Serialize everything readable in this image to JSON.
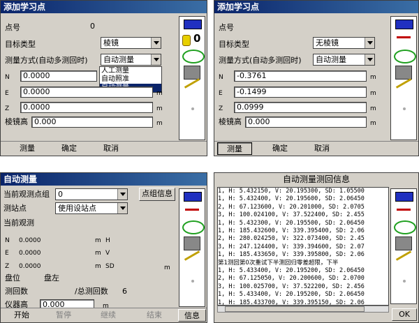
{
  "p1": {
    "title": "添加学习点",
    "point_no_label": "点号",
    "point_no_value": "0",
    "target_type_label": "目标类型",
    "target_type_value": "棱镜",
    "mode_label": "测量方式(自动多测回时)",
    "mode_value": "自动测量",
    "dropdown_options": [
      "人工测量",
      "自动照准",
      "自动测量"
    ],
    "n_label": "N",
    "n_value": "0.0000",
    "e_label": "E",
    "e_value": "0.0000",
    "z_label": "Z",
    "z_value": "0.0000",
    "prism_label": "棱镜高",
    "prism_value": "0.000",
    "unit": "m",
    "side_count": "0",
    "buttons": [
      "测量",
      "确定",
      "取消"
    ]
  },
  "p2": {
    "title": "添加学习点",
    "point_no_label": "点号",
    "target_type_label": "目标类型",
    "target_type_value": "无棱镜",
    "mode_label": "测量方式(自动多测回时)",
    "mode_value": "自动测量",
    "n_label": "N",
    "n_value": "-0.3761",
    "e_label": "E",
    "e_value": "-0.1499",
    "z_label": "Z",
    "z_value": "0.0999",
    "prism_label": "棱镜高",
    "prism_value": "0.000",
    "unit": "m",
    "buttons": [
      "测量",
      "确定",
      "取消"
    ]
  },
  "p3": {
    "title": "自动测量",
    "group_label": "当前观测点组",
    "group_value": "0",
    "group_btn": "点组信息",
    "station_label": "测站点",
    "station_value": "使用设站点",
    "obs_label": "当前观测",
    "n_label": "N",
    "n_value": "0.0000",
    "n_unit": "m",
    "n_right": "H",
    "e_label": "E",
    "e_value": "0.0000",
    "e_unit": "m",
    "e_right": "V",
    "z_label": "Z",
    "z_value": "0.0000",
    "z_unit": "m",
    "z_right": "SD",
    "z_unit2": "m",
    "face_label": "盘位",
    "face_value": "盘左",
    "rounds_label": "测回数",
    "total_label": "/总测回数",
    "total_value": "6",
    "inst_label": "仪器高",
    "inst_value": "0.000",
    "inst_unit": "m",
    "buttons": [
      "开始",
      "暂停",
      "继续",
      "结束",
      "信息"
    ]
  },
  "p4": {
    "title": "自动测量测回信息",
    "ok": "OK",
    "lines": [
      "1, H: 5.432150, V: 20.195300, SD: 1.05500",
      "1, H: 5.432400, V: 20.195600, SD: 2.06450",
      "2, H: 67.123600, V: 20.201000, SD: 2.0705",
      "3, H: 100.024100, V: 37.522400, SD: 2.455",
      "1, H: 5.432300, V: 20.195500, SD: 2.06450",
      "1, H: 185.432600, V: 339.395400, SD: 2.06",
      "2, H: 280.024250, V: 322.073400, SD: 2.45",
      "3, H: 247.124400, V: 339.394600, SD: 2.07",
      "1, H: 185.433650, V: 339.395800, SD: 2.06",
      "第1测回第0次重试下半测回归零差超限，下半",
      "1, H: 5.433400, V: 20.195200, SD: 2.06450",
      "2, H: 67.125050, V: 20.200600, SD: 2.0700",
      "3, H: 100.025700, V: 37.522200, SD: 2.456",
      "1, H: 5.433400, V: 20.195200, SD: 2.06450",
      "1, H: 185.433700, V: 339.395150, SD: 2.06"
    ]
  }
}
